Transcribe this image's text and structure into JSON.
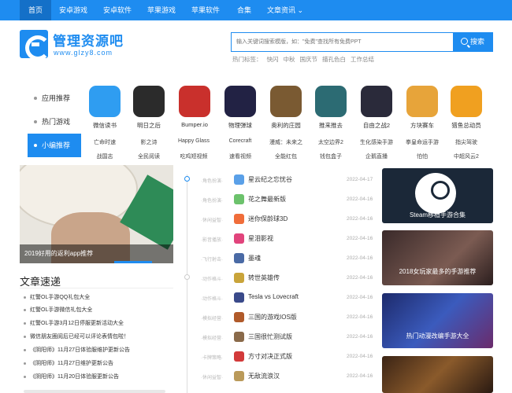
{
  "topnav": {
    "items": [
      "首页",
      "安卓游戏",
      "安卓软件",
      "苹果游戏",
      "苹果软件",
      "合集",
      "文章资讯 ⌄"
    ]
  },
  "logo": {
    "title": "管理资源吧",
    "subtitle": "www.glzy8.com"
  },
  "search": {
    "placeholder": "输入关键词搜索模版，如：\"免费\"查找所有免费PPT",
    "button": "搜索"
  },
  "hot": {
    "label": "热门标签：",
    "tags": [
      "快闪",
      "中秋",
      "国庆节",
      "描孔色白",
      "工作总结"
    ]
  },
  "tabs": [
    "应用推荐",
    "热门游戏",
    "小编推荐"
  ],
  "apps": [
    {
      "name": "微信读书",
      "color": "#2f9df1"
    },
    {
      "name": "明日之后",
      "color": "#2b2b2b"
    },
    {
      "name": "Bumper.io",
      "color": "#c9302c"
    },
    {
      "name": "物理弹球",
      "color": "#222244"
    },
    {
      "name": "奥利的庄园",
      "color": "#7a5a32"
    },
    {
      "name": "推来推去",
      "color": "#2c6b73"
    },
    {
      "name": "自由之战2",
      "color": "#2a2a3a"
    },
    {
      "name": "方块赛车",
      "color": "#e7a43a"
    },
    {
      "name": "猎鱼总动员",
      "color": "#f0a020"
    }
  ],
  "tags": [
    [
      "亡命时速",
      "影之诗",
      "Happy Glass",
      "Corecraft",
      "漫威：未来之",
      "太空边界2",
      "生化感染手游",
      "拳皇命运手游",
      "指尖驾驶"
    ],
    [
      "战国志",
      "全民阅读",
      "吃鸡短视频",
      "速看视频",
      "全能红包",
      "钱包盒子",
      "企鹅直播",
      "怕怕",
      "中超风云2"
    ]
  ],
  "banner": {
    "caption": "2019好用的返利app推荐"
  },
  "articles": {
    "title": "文章速递",
    "items": [
      "红警OL手游QQ礼包大全",
      "红警OL手游微信礼包大全",
      "红警OL手游3月12日停服更新活动大全",
      "微信朋友圈阅后已经可以评论表情包啦！",
      "《阴阳师》11月27日体验服维护更新公告",
      "《阴阳师》11月27日维护更新公告",
      "《阴阳师》11月20日体验服更新公告"
    ]
  },
  "list": [
    {
      "cat": "·角色扮演·",
      "title": "星云纪之忘忧谷",
      "date": "2022-04-17",
      "color": "#5aa0e8"
    },
    {
      "cat": "·角色扮演·",
      "title": "花之舞最新版",
      "date": "2022-04-16",
      "color": "#6cc26c"
    },
    {
      "cat": "·休闲益智·",
      "title": "迷你保龄球3D",
      "date": "2022-04-16",
      "color": "#f06d3a"
    },
    {
      "cat": "·影音播放·",
      "title": "星泪影视",
      "date": "2022-04-16",
      "color": "#e1447c"
    },
    {
      "cat": "·飞行射击·",
      "title": "墨魂",
      "date": "2022-04-16",
      "color": "#4a6aa5"
    },
    {
      "cat": "·动作格斗·",
      "title": "转世英雄传",
      "date": "2022-04-16",
      "color": "#c9a43a"
    },
    {
      "cat": "·动作格斗·",
      "title": "Tesla vs Lovecraft",
      "date": "2022-04-16",
      "color": "#3a4a8a"
    },
    {
      "cat": "·模拟经营·",
      "title": "三国的游戏IOS版",
      "date": "2022-04-16",
      "color": "#b05a2a"
    },
    {
      "cat": "·模拟经营·",
      "title": "三国很忙测试版",
      "date": "2022-04-16",
      "color": "#8a6a4a"
    },
    {
      "cat": "·卡牌策略·",
      "title": "方寸对决正式版",
      "date": "2022-04-16",
      "color": "#d23a3a"
    },
    {
      "cat": "·休闲益智·",
      "title": "无敌流浪汉",
      "date": "2022-04-16",
      "color": "#ba9a5a"
    }
  ],
  "cards": [
    "Steam移植手游合集",
    "2018女玩家最多的手游推荐",
    "热门动漫改编手游大全",
    ""
  ]
}
